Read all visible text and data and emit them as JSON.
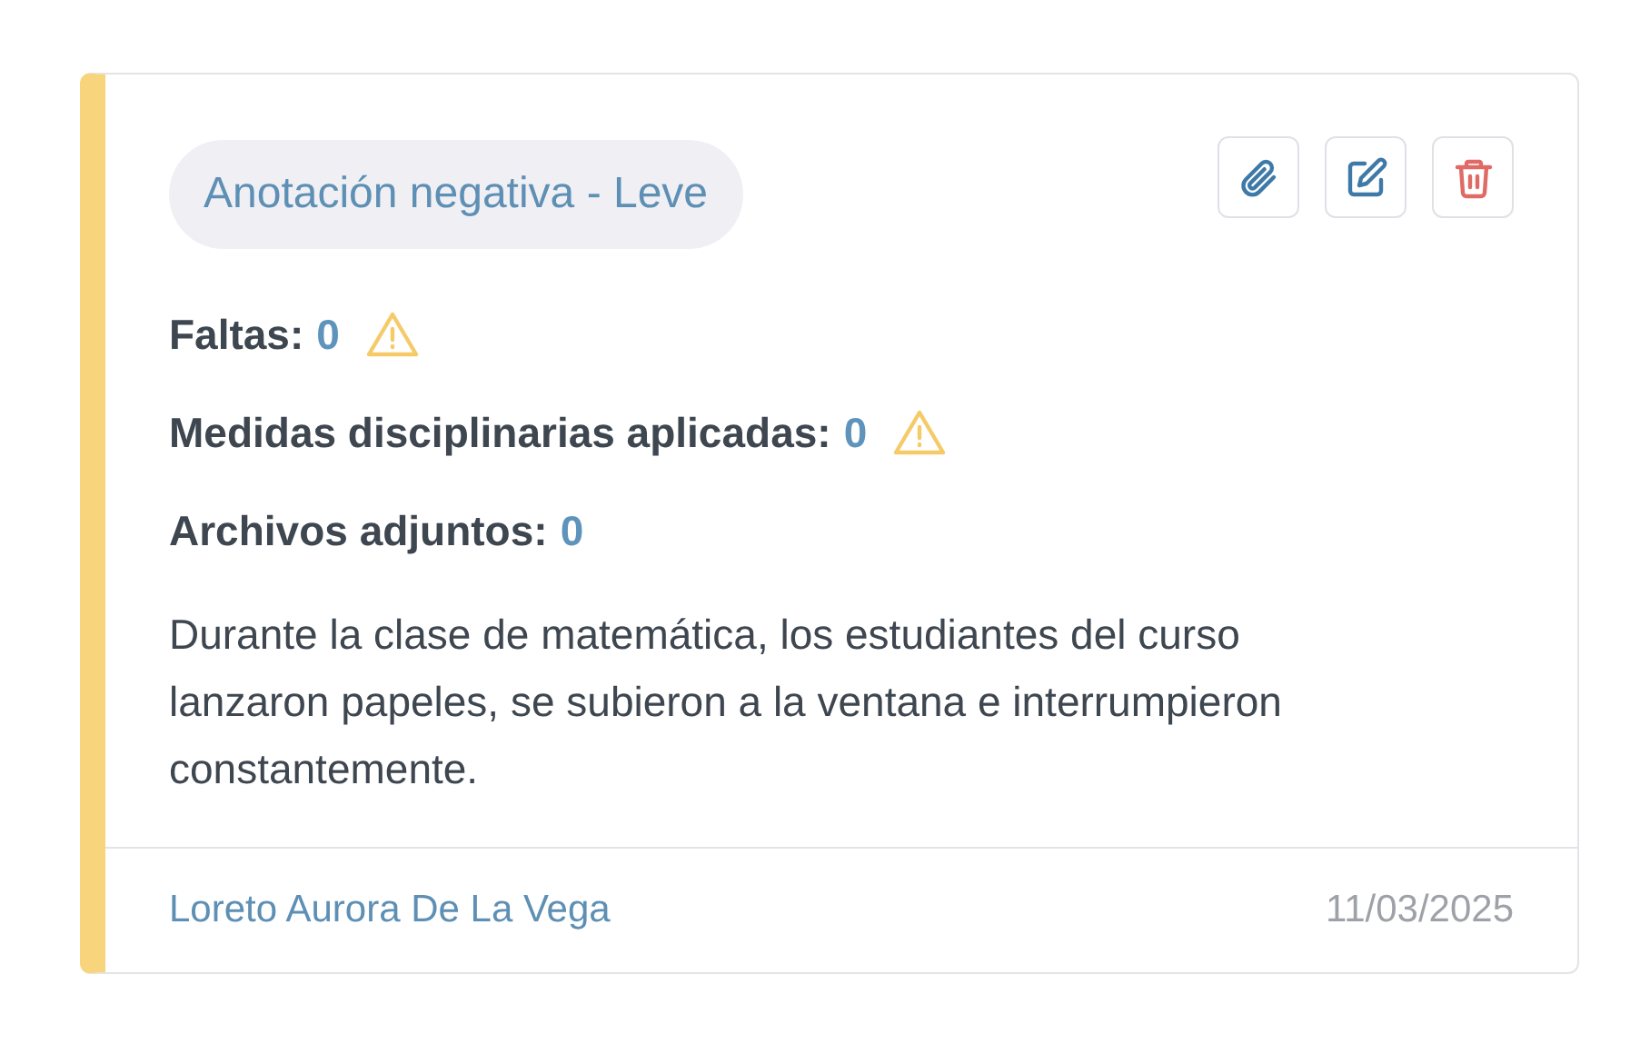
{
  "card": {
    "tag": "Anotación negativa - Leve",
    "actions": [
      {
        "kind": "attach"
      },
      {
        "kind": "edit"
      },
      {
        "kind": "delete"
      }
    ],
    "stats": [
      {
        "label": "Faltas:",
        "value": "0",
        "warning": true
      },
      {
        "label": "Medidas disciplinarias aplicadas:",
        "value": "0",
        "warning": true
      },
      {
        "label": "Archivos adjuntos:",
        "value": "0",
        "warning": false
      }
    ],
    "description": "Durante la clase de matemática, los estudiantes del curso lanzaron papeles, se subieron a la ventana e interrumpieron constantemente.",
    "author": "Loreto Aurora De La Vega",
    "date": "11/03/2025"
  }
}
